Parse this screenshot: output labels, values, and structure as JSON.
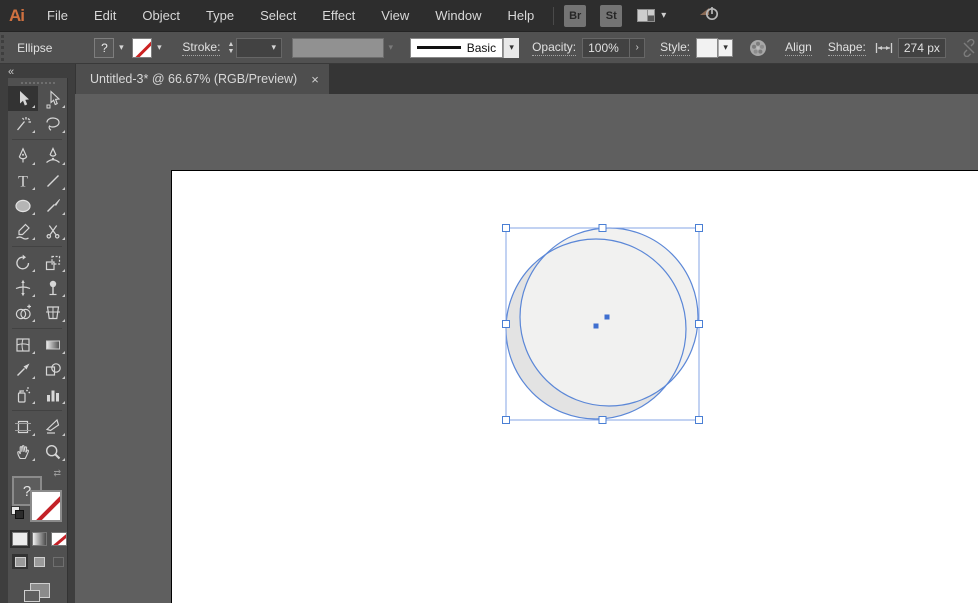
{
  "colors": {
    "accent_selection_blue": "#4a7fd4",
    "selection_outline_blue": "#5b87d7",
    "logo_orange": "#cf7140",
    "stroke_none_red": "#c42127",
    "ui_dark": "#2d2d2d",
    "ui_panel": "#505050",
    "pasteboard": "#5f5f5f",
    "artboard": "#ffffff"
  },
  "menu_bar": {
    "logo": "Ai",
    "items": [
      "File",
      "Edit",
      "Object",
      "Type",
      "Select",
      "Effect",
      "View",
      "Window",
      "Help"
    ],
    "bridge_button": "Br",
    "stock_button": "St",
    "workspace_icon": "workspace-switcher-icon",
    "workspace_chevron": "▾",
    "share_icon": "share-power-icon"
  },
  "control_bar": {
    "context_label": "Ellipse",
    "fill_unknown_glyph": "?",
    "fill_chevron": "▾",
    "stroke_none_chevron": "▾",
    "stroke_label": "Stroke:",
    "stepper_up": "▲",
    "stepper_down": "▼",
    "stroke_width_value": "",
    "brush_value": "",
    "stroke_style_value": "Basic",
    "opacity_label": "Opacity:",
    "opacity_value": "100%",
    "opacity_arrow": "›",
    "style_label": "Style:",
    "recolor_icon": "recolor-artwork-icon",
    "align_label": "Align",
    "shape_label": "Shape:",
    "shape_width_icon": "width-measure-icon",
    "shape_width_value": "274 px",
    "constrain_icon": "broken-link-icon"
  },
  "tab": {
    "title": "Untitled-3* @ 66.67% (RGB/Preview)",
    "close_glyph": "×"
  },
  "toolbar": {
    "collapse_glyph": "«",
    "fill_indicator_glyph": "?",
    "swap_glyph": "⇄",
    "tool_groups": [
      [
        {
          "name": "selection-tool",
          "icon": "selection",
          "active": true
        },
        {
          "name": "direct-selection-tool",
          "icon": "direct-selection",
          "active": false
        },
        {
          "name": "magic-wand-tool",
          "icon": "magic-wand",
          "active": false
        },
        {
          "name": "lasso-tool",
          "icon": "lasso",
          "active": false
        }
      ],
      [
        {
          "name": "pen-tool",
          "icon": "pen",
          "active": false
        },
        {
          "name": "curvature-tool",
          "icon": "curvature",
          "active": false
        },
        {
          "name": "type-tool",
          "icon": "type",
          "active": false
        },
        {
          "name": "line-segment-tool",
          "icon": "line",
          "active": false
        },
        {
          "name": "ellipse-tool",
          "icon": "ellipse",
          "active": false
        },
        {
          "name": "paintbrush-tool",
          "icon": "paintbrush",
          "active": false
        },
        {
          "name": "shaper-tool",
          "icon": "shaper",
          "active": false
        },
        {
          "name": "scissors-tool",
          "icon": "scissors",
          "active": false
        }
      ],
      [
        {
          "name": "rotate-tool",
          "icon": "rotate",
          "active": false
        },
        {
          "name": "scale-tool",
          "icon": "scale",
          "active": false
        },
        {
          "name": "width-tool",
          "icon": "width",
          "active": false
        },
        {
          "name": "puppet-warp-tool",
          "icon": "puppet",
          "active": false
        },
        {
          "name": "shape-builder-tool",
          "icon": "shape-builder",
          "active": false
        },
        {
          "name": "perspective-grid-tool",
          "icon": "perspective",
          "active": false
        }
      ],
      [
        {
          "name": "mesh-tool",
          "icon": "mesh",
          "active": false
        },
        {
          "name": "gradient-tool",
          "icon": "gradient",
          "active": false
        },
        {
          "name": "eyedropper-tool",
          "icon": "eyedropper",
          "active": false
        },
        {
          "name": "blend-tool",
          "icon": "blend",
          "active": false
        },
        {
          "name": "symbol-sprayer-tool",
          "icon": "symbol-sprayer",
          "active": false
        },
        {
          "name": "column-graph-tool",
          "icon": "graph",
          "active": false
        }
      ],
      [
        {
          "name": "artboard-tool",
          "icon": "artboard",
          "active": false
        },
        {
          "name": "slice-tool",
          "icon": "slice",
          "active": false
        },
        {
          "name": "hand-tool",
          "icon": "hand",
          "active": false
        },
        {
          "name": "zoom-tool",
          "icon": "zoom",
          "active": false
        }
      ]
    ]
  }
}
